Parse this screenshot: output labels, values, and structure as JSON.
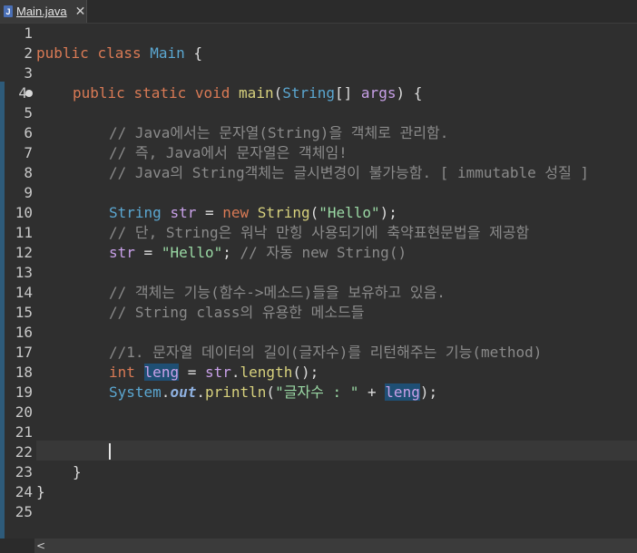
{
  "tab": {
    "icon": "J",
    "label": "Main.java",
    "close": "✕"
  },
  "lines": {
    "n1": "1",
    "n2": "2",
    "n3": "3",
    "n4": "4",
    "n5": "5",
    "n6": "6",
    "n7": "7",
    "n8": "8",
    "n9": "9",
    "n10": "10",
    "n11": "11",
    "n12": "12",
    "n13": "13",
    "n14": "14",
    "n15": "15",
    "n16": "16",
    "n17": "17",
    "n18": "18",
    "n19": "19",
    "n20": "20",
    "n21": "21",
    "n22": "22",
    "n23": "23",
    "n24": "24",
    "n25": "25"
  },
  "code": {
    "l2": {
      "kw1": "public",
      "kw2": "class",
      "cls": "Main",
      "rest": " {"
    },
    "l4": {
      "kw1": "public",
      "kw2": "static",
      "kw3": "void",
      "mth": "main",
      "p1": "(",
      "cls": "String",
      "p2": "[] ",
      "var": "args",
      "p3": ") {"
    },
    "l6": "// Java에서는 문자열(String)을 객체로 관리함.",
    "l7": "// 즉, Java에서 문자열은 객체임!",
    "l8": "// Java의 String객체는 글시변경이 불가능함. [ immutable 성질 ]",
    "l10": {
      "cls1": "String",
      "var": "str",
      "eq": " = ",
      "kw": "new",
      "cls2": "String",
      "p1": "(",
      "str": "\"Hello\"",
      "p2": ");"
    },
    "l11": "// 단, String은 워낙 만힝 사용되기에 축약표현문법을 제공함",
    "l12": {
      "var": "str",
      "eq": " = ",
      "str": "\"Hello\"",
      "semi": "; ",
      "cmt": "// 자동 new String()"
    },
    "l14": "// 객체는 기능(함수->메소드)들을 보유하고 있음.",
    "l15": "// String class의 유용한 메소드들",
    "l17": "//1. 문자열 데이터의 길이(글자수)를 리턴해주는 기능(method)",
    "l18": {
      "kw": "int",
      "var": "leng",
      "eq": " = ",
      "obj": "str",
      "dot": ".",
      "mth": "length",
      "rest": "();"
    },
    "l19": {
      "cls": "System",
      "dot1": ".",
      "fld": "out",
      "dot2": ".",
      "mth": "println",
      "p1": "(",
      "str": "\"글자수 : \"",
      "plus": " + ",
      "var": "leng",
      "p2": ");"
    },
    "l23": "}",
    "l24": "}"
  },
  "scroll": {
    "left_arrow": "<"
  },
  "colors": {
    "background": "#2f2f2f",
    "keyword": "#d97a55",
    "class": "#5ba7d1",
    "method": "#d7d17d",
    "string": "#9ad8a4",
    "comment": "#8a8a8a",
    "variable": "#c8a0e8",
    "highlight": "#1f4f74"
  }
}
